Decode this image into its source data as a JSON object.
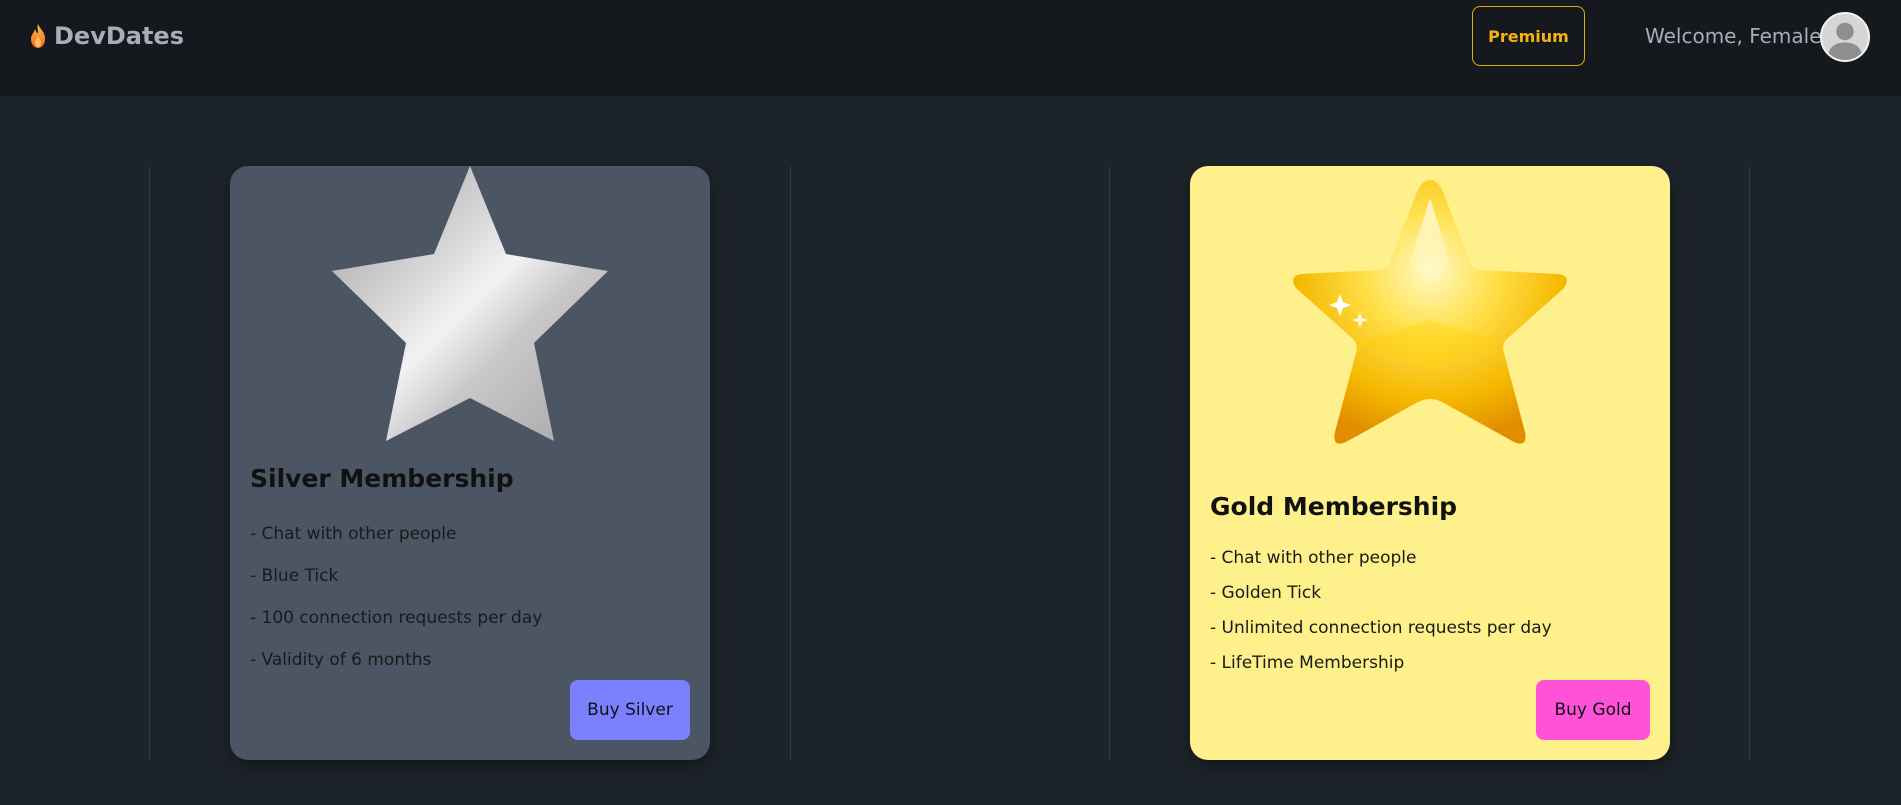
{
  "navbar": {
    "brand": "DevDates",
    "premium_label": "Premium",
    "welcome_text": "Welcome, Female",
    "icons": {
      "brand": "flame-icon",
      "avatar": "user-avatar-icon"
    }
  },
  "cards": [
    {
      "id": "silver",
      "title": "Silver Membership",
      "features": [
        "- Chat with other people",
        "- Blue Tick",
        "- 100 connection requests per day",
        "- Validity of 6 months"
      ],
      "button_label": "Buy Silver",
      "colors": {
        "background": "#4b5563",
        "button": "#7b80ff"
      }
    },
    {
      "id": "gold",
      "title": "Gold Membership",
      "features": [
        "- Chat with other people",
        "- Golden Tick",
        "- Unlimited connection requests per day",
        "- LifeTime Membership"
      ],
      "button_label": "Buy Gold",
      "colors": {
        "background": "#fef08a",
        "button": "#ff52d9"
      }
    }
  ],
  "colors": {
    "page_background": "#1d232a",
    "navbar_background": "#15191e",
    "premium_accent": "#f4b213"
  }
}
